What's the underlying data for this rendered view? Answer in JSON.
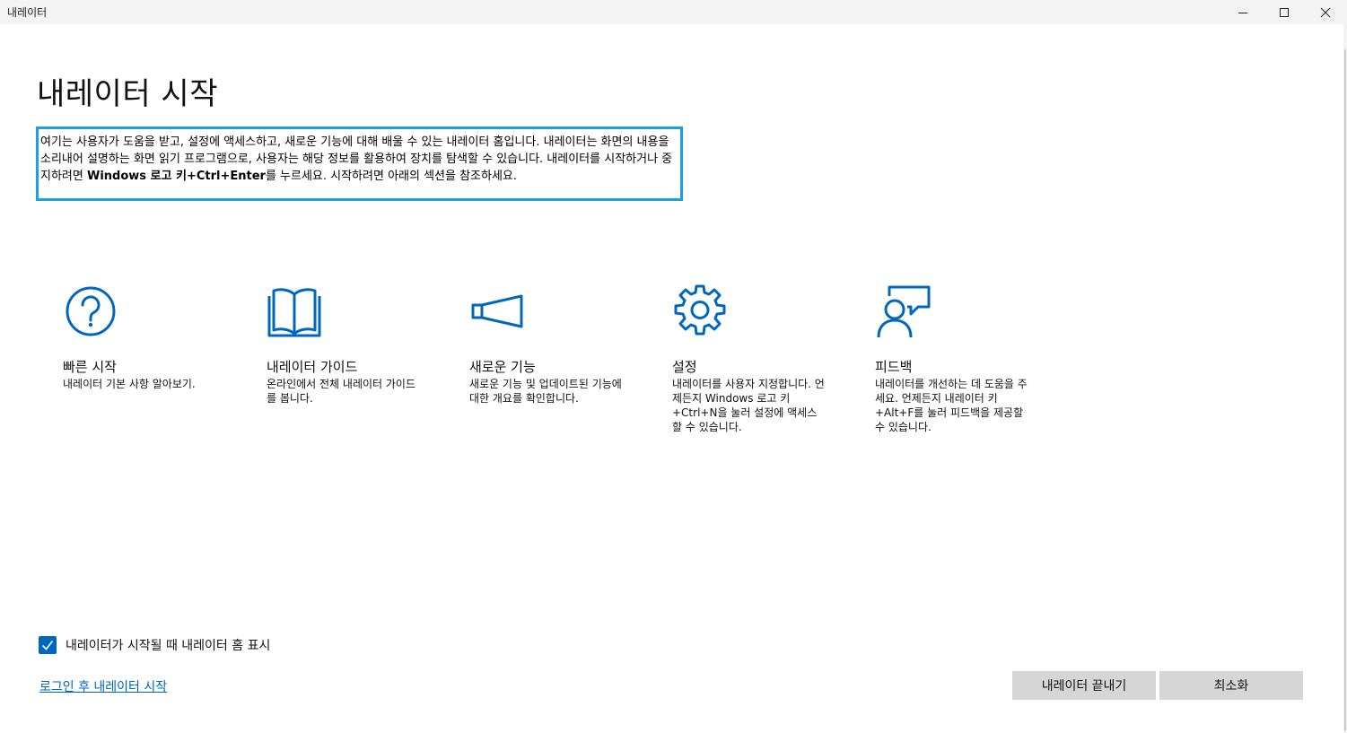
{
  "window": {
    "title": "내레이터",
    "controls": [
      "minimize-icon",
      "maximize-icon",
      "close-icon"
    ]
  },
  "main": {
    "heading": "내레이터 시작",
    "intro_parts": [
      "여기는 사용자가 도움을 받고, 설정에 액세스하고, 새로운 기능에 대해 배울 수 있는 내레이터 홈입니다. 내레이터는 화면의 내용을 소리내어 설명하는 화면 읽기 프로그램으로, 사용자는 해당 정보를 활용하여 장치를 탐색할 수 있습니다. 내레이터를 시작하거나 중지하려면 ",
      "Windows 로고 키+Ctrl+Enter",
      "를 누르세요. 시작하려면 아래의 섹션을 참조하세요."
    ]
  },
  "tiles": [
    {
      "icon": "help-circle-icon",
      "title": "빠른 시작",
      "desc": "내레이터 기본 사항 알아보기."
    },
    {
      "icon": "book-icon",
      "title": "내레이터 가이드",
      "desc": "온라인에서 전체 내레이터 가이드를 봅니다."
    },
    {
      "icon": "megaphone-icon",
      "title": "새로운 기능",
      "desc": "새로운 기능 및 업데이트된 기능에 대한 개요를 확인합니다."
    },
    {
      "icon": "gear-icon",
      "title": "설정",
      "desc": "내레이터를 사용자 지정합니다. 언제든지 Windows 로고 키+Ctrl+N을 눌러 설정에 액세스할 수 있습니다."
    },
    {
      "icon": "feedback-person-icon",
      "title": "피드백",
      "desc": "내레이터를 개선하는 데 도움을 주세요. 언제든지 내레이터 키+Alt+F를 눌러 피드백을 제공할 수 있습니다."
    }
  ],
  "footer": {
    "checkbox_label": "내레이터가 시작될 때 내레이터 홈 표시",
    "checkbox_checked": true,
    "link_text": "로그인 후 내레이터 시작",
    "exit_button": "내레이터 끝내기",
    "minimize_button": "최소화"
  },
  "colors": {
    "accent": "#0067c0",
    "focus_border": "#1ba1e2",
    "titlebar": "#f3f3f3",
    "button_bg": "#d6d6d6"
  }
}
